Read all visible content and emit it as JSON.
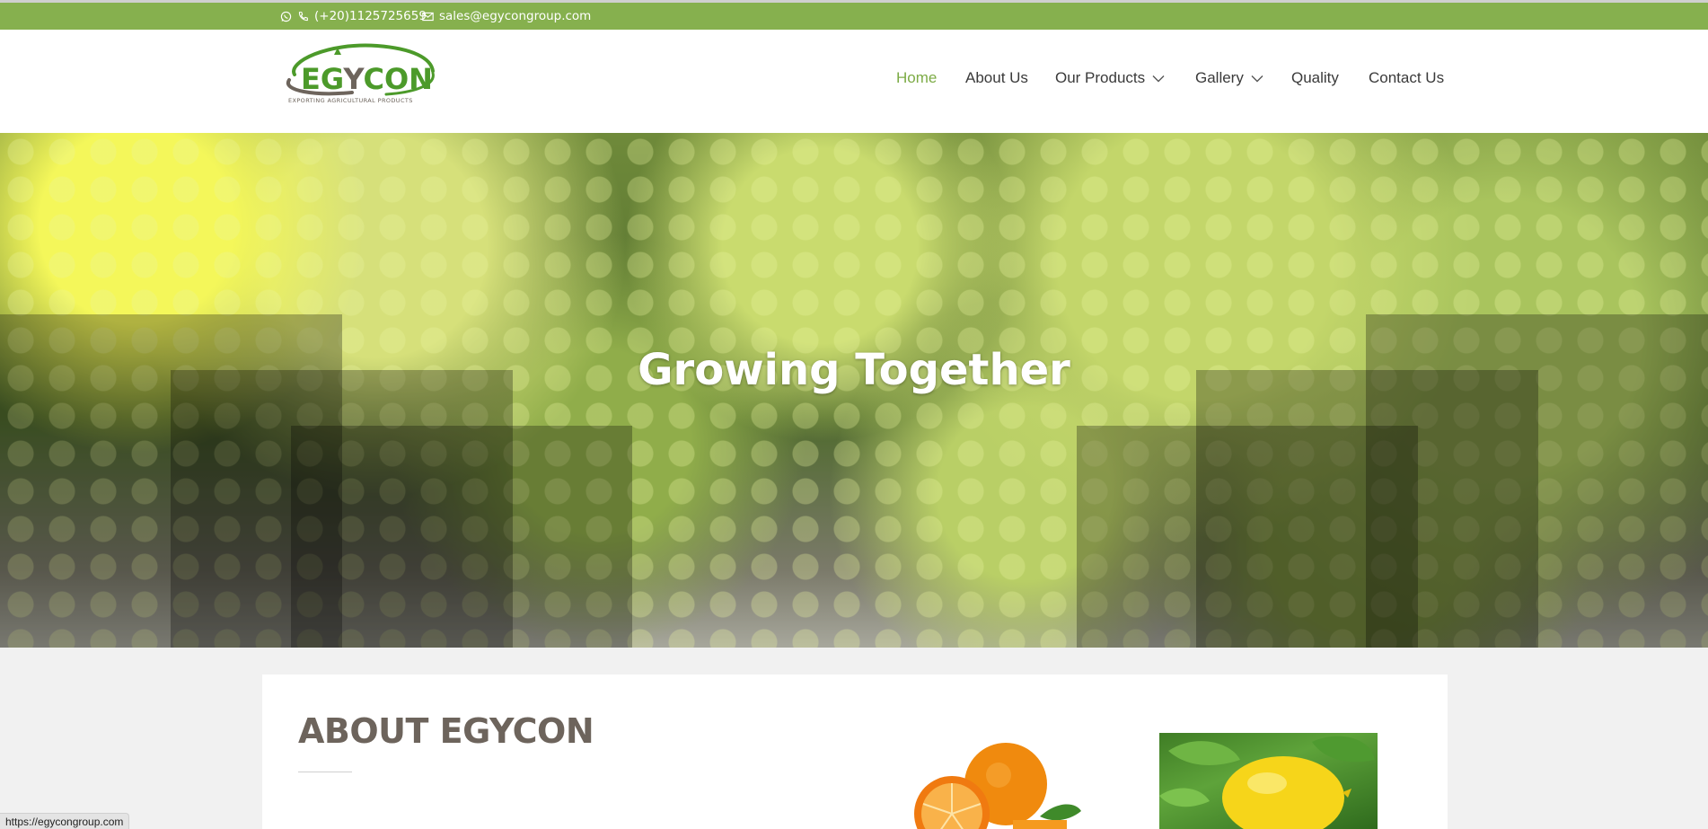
{
  "topbar": {
    "phone": "(+20)1125725659",
    "email": "sales@egycongroup.com",
    "icons": [
      "whatsapp-icon",
      "phone-icon",
      "envelope-icon"
    ],
    "bg_color": "#86b04e"
  },
  "logo": {
    "word_left": "EG",
    "word_mid": "Y",
    "word_right": "CON",
    "tagline": "EXPORTING AGRICULTURAL PRODUCTS"
  },
  "nav": {
    "home": "Home",
    "about": "About Us",
    "products": "Our Products",
    "gallery": "Gallery",
    "quality": "Quality",
    "contact": "Contact Us",
    "active_color": "#7cab45"
  },
  "hero": {
    "title": "Growing Together"
  },
  "about": {
    "title": "ABOUT EGYCON"
  },
  "status": {
    "url": "https://egycongroup.com"
  }
}
